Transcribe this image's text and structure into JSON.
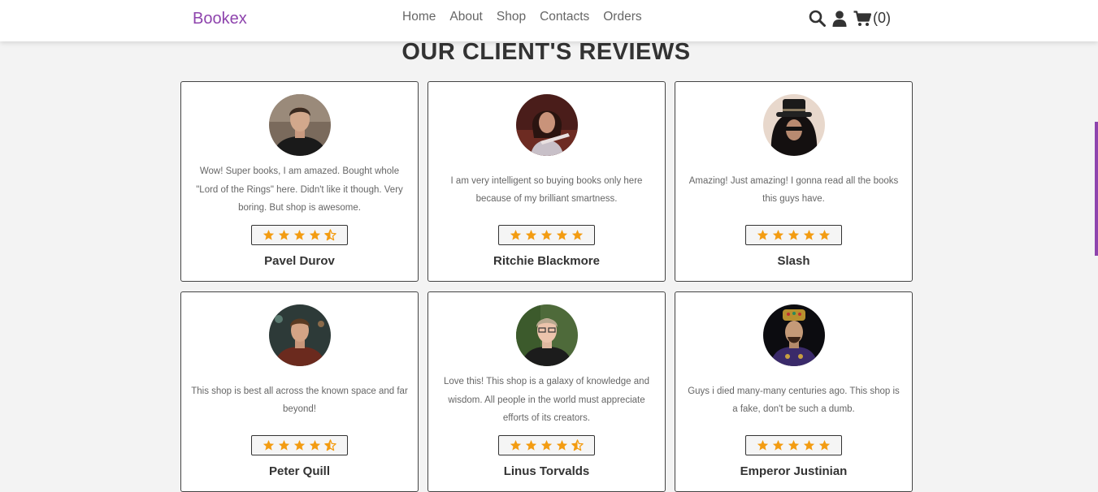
{
  "header": {
    "logo": "Bookex",
    "nav": [
      "Home",
      "About",
      "Shop",
      "Contacts",
      "Orders"
    ],
    "cart_count": "(0)"
  },
  "section": {
    "title": "OUR CLIENT'S REVIEWS"
  },
  "reviews": [
    {
      "text": "Wow! Super books, I am amazed. Bought whole \"Lord of the Rings\" here. Didn't like it though. Very boring. But shop is awesome.",
      "rating": 4.5,
      "name": "Pavel Durov"
    },
    {
      "text": "I am very intelligent so buying books only here because of my brilliant smartness.",
      "rating": 5,
      "name": "Ritchie Blackmore"
    },
    {
      "text": "Amazing! Just amazing! I gonna read all the books this guys have.",
      "rating": 5,
      "name": "Slash"
    },
    {
      "text": "This shop is best all across the known space and far beyond!",
      "rating": 4.5,
      "name": "Peter Quill"
    },
    {
      "text": "Love this! This shop is a galaxy of knowledge and wisdom. All people in the world must appreciate efforts of its creators.",
      "rating": 4.5,
      "name": "Linus Torvalds"
    },
    {
      "text": "Guys i died many-many centuries ago. This shop is a fake, don't be such a dumb.",
      "rating": 5,
      "name": "Emperor Justinian"
    }
  ],
  "colors": {
    "brand": "#8e44ad",
    "star": "#f39c12"
  }
}
